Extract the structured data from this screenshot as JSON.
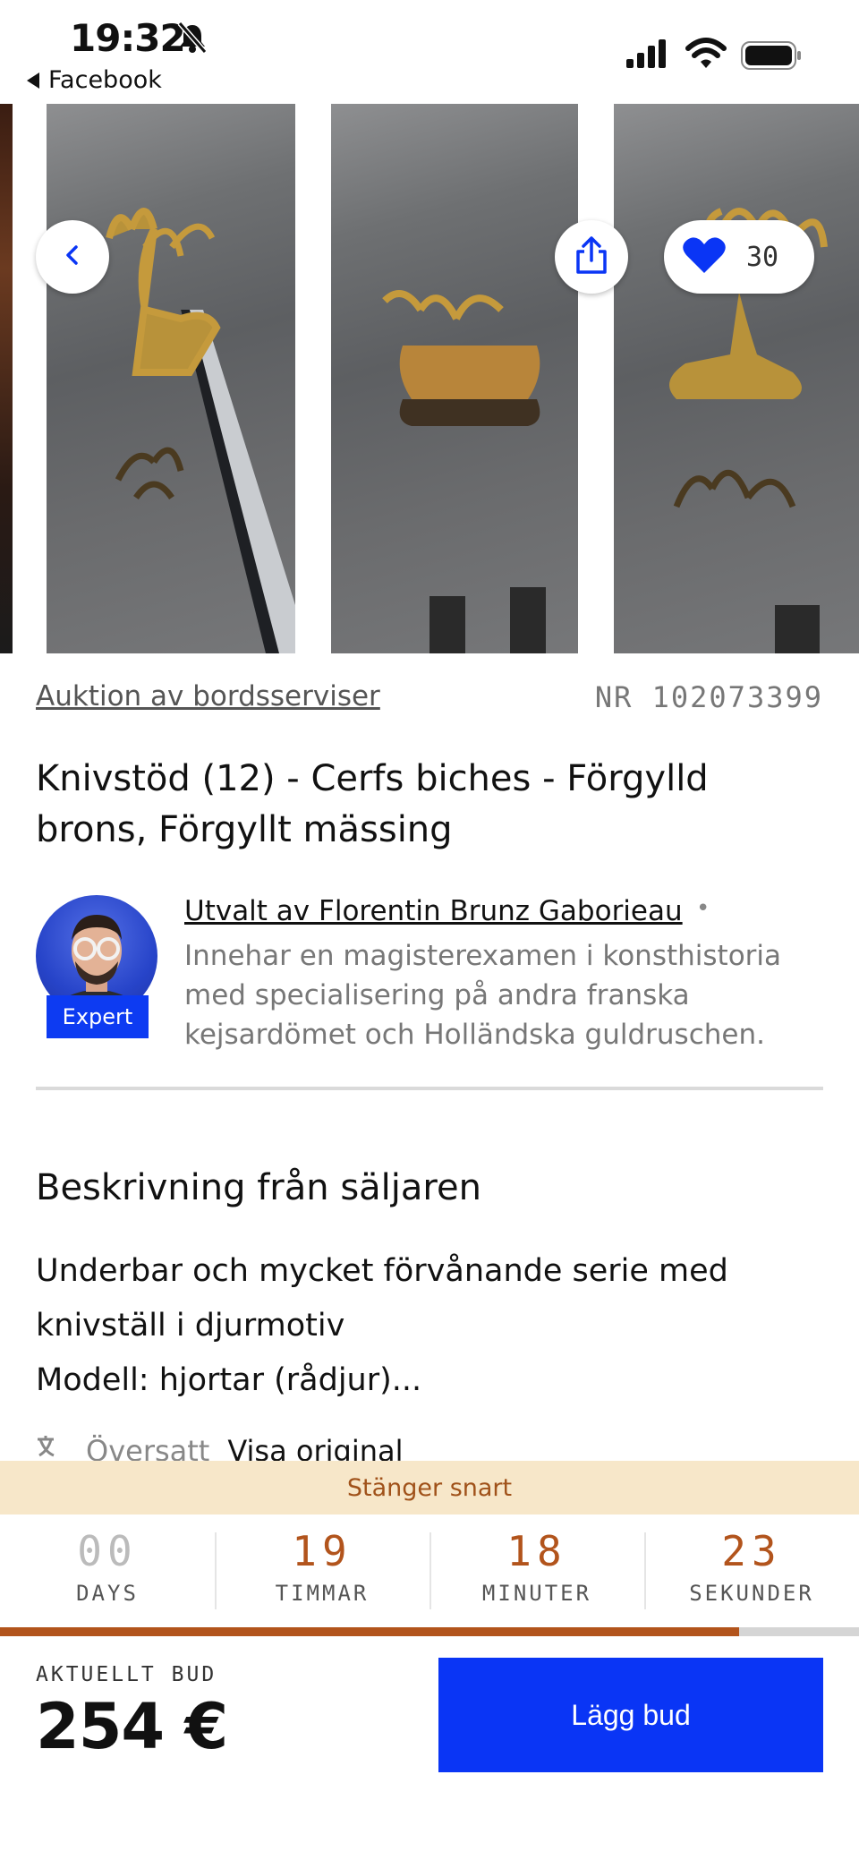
{
  "status_bar": {
    "time": "19:32",
    "back_app": "Facebook",
    "icons": [
      "bell-muted-icon",
      "signal-icon",
      "wifi-icon",
      "battery-icon"
    ]
  },
  "gallery": {
    "favorites_count": "30",
    "icons": [
      "chevron-left-icon",
      "share-icon",
      "heart-icon"
    ]
  },
  "lot": {
    "category_link": "Auktion av bordsserviser",
    "number": "NR 102073399",
    "title": "Knivstöd (12) - Cerfs biches - Förgylld brons, Förgyllt mässing"
  },
  "expert": {
    "badge": "Expert",
    "name": "Utvalt av Florentin Brunz Gaborieau",
    "separator": "•",
    "bio": "Innehar en magisterexamen i konsthistoria med specialisering på andra franska kejsardömet och Holländska guldruschen."
  },
  "description": {
    "heading": "Beskrivning från säljaren",
    "line1": "Underbar och mycket förvånande serie med knivställ i djurmotiv",
    "line2": "Modell: hjortar (rådjur)...",
    "translated_label": "Översatt",
    "show_original": "Visa original"
  },
  "auction": {
    "closing_text": "Stänger snart",
    "countdown": [
      {
        "value": "00",
        "label": "DAYS"
      },
      {
        "value": "19",
        "label": "TIMMAR"
      },
      {
        "value": "18",
        "label": "MINUTER"
      },
      {
        "value": "23",
        "label": "SEKUNDER"
      }
    ],
    "progress_fraction": 0.86,
    "current_bid_label": "AKTUELLT BUD",
    "current_bid": "254 €",
    "bid_button": "Lägg bud"
  },
  "colors": {
    "accent_blue": "#0a35f5",
    "countdown_orange": "#b2541c",
    "closing_bg": "#f7e7c9"
  }
}
